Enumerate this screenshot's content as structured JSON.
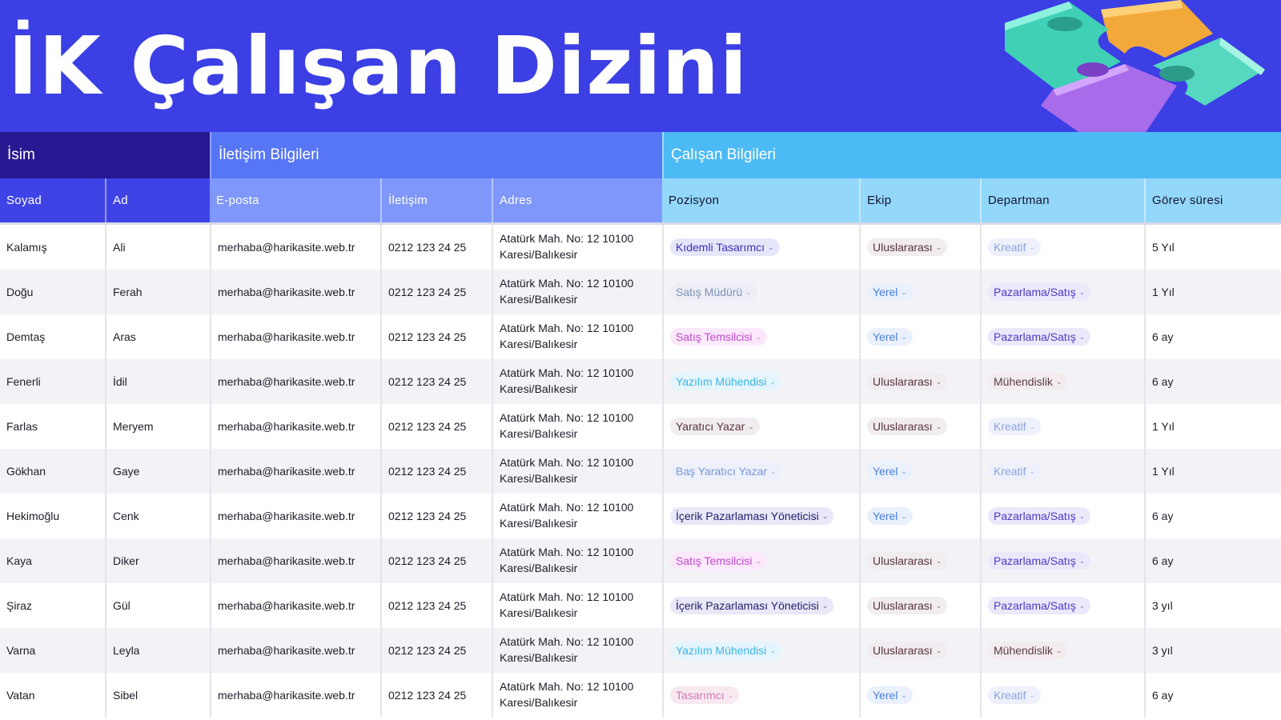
{
  "page": {
    "title": "İK Çalışan Dizini"
  },
  "groups": {
    "name": "İsim",
    "contact": "İletişim Bilgileri",
    "employee": "Çalışan Bilgileri"
  },
  "columns": {
    "surname": "Soyad",
    "first_name": "Ad",
    "email": "E-posta",
    "phone": "İletişim",
    "address": "Adres",
    "position": "Pozisyon",
    "team": "Ekip",
    "department": "Departman",
    "tenure": "Görev süresi"
  },
  "colors": {
    "banner": "#3b3fe4",
    "group_name": "#281891",
    "group_contact": "#5776f5",
    "group_employee": "#4bbaf5",
    "header_name": "#3f43e6",
    "header_contact": "#7f97fa",
    "header_employee": "#93d7fb"
  },
  "rows": [
    {
      "surname": "Kalamış",
      "first_name": "Ali",
      "email": "merhaba@harikasite.web.tr",
      "phone": "0212 123 24 25",
      "address_line1": "Atatürk Mah. No: 12 10100",
      "address_line2": "Karesi/Balıkesir",
      "position": "Kıdemli Tasarımcı",
      "position_color": "indigo",
      "team": "Uluslararası",
      "team_color": "brown",
      "department": "Kreatif",
      "department_color": "periwinkle",
      "tenure": "5 Yıl"
    },
    {
      "surname": "Doğu",
      "first_name": "Ferah",
      "email": "merhaba@harikasite.web.tr",
      "phone": "0212 123 24 25",
      "address_line1": "Atatürk Mah. No: 12 10100",
      "address_line2": "Karesi/Balıkesir",
      "position": "Satış Müdürü",
      "position_color": "slate",
      "team": "Yerel",
      "team_color": "blue",
      "department": "Pazarlama/Satış",
      "department_color": "violet",
      "tenure": "1 Yıl"
    },
    {
      "surname": "Demtaş",
      "first_name": "Aras",
      "email": "merhaba@harikasite.web.tr",
      "phone": "0212 123 24 25",
      "address_line1": "Atatürk Mah. No: 12 10100",
      "address_line2": "Karesi/Balıkesir",
      "position": "Satış Temsilcisi",
      "position_color": "pink",
      "team": "Yerel",
      "team_color": "blue",
      "department": "Pazarlama/Satış",
      "department_color": "violet",
      "tenure": "6 ay"
    },
    {
      "surname": "Fenerli",
      "first_name": "İdil",
      "email": "merhaba@harikasite.web.tr",
      "phone": "0212 123 24 25",
      "address_line1": "Atatürk Mah. No: 12 10100",
      "address_line2": "Karesi/Balıkesir",
      "position": "Yazılım Mühendisi",
      "position_color": "cyan",
      "team": "Uluslararası",
      "team_color": "brown",
      "department": "Mühendislik",
      "department_color": "maroon",
      "tenure": "6 ay"
    },
    {
      "surname": "Farlas",
      "first_name": "Meryem",
      "email": "merhaba@harikasite.web.tr",
      "phone": "0212 123 24 25",
      "address_line1": "Atatürk Mah. No: 12 10100",
      "address_line2": "Karesi/Balıkesir",
      "position": "Yaratıcı Yazar",
      "position_color": "brown",
      "team": "Uluslararası",
      "team_color": "brown",
      "department": "Kreatif",
      "department_color": "periwinkle",
      "tenure": "1 Yıl"
    },
    {
      "surname": "Gökhan",
      "first_name": "Gaye",
      "email": "merhaba@harikasite.web.tr",
      "phone": "0212 123 24 25",
      "address_line1": "Atatürk Mah. No: 12 10100",
      "address_line2": "Karesi/Balıkesir",
      "position": "Baş Yaratıcı Yazar",
      "position_color": "lightblue",
      "team": "Yerel",
      "team_color": "blue",
      "department": "Kreatif",
      "department_color": "periwinkle",
      "tenure": "1 Yıl"
    },
    {
      "surname": "Hekimoğlu",
      "first_name": "Cenk",
      "email": "merhaba@harikasite.web.tr",
      "phone": "0212 123 24 25",
      "address_line1": "Atatürk Mah. No: 12 10100",
      "address_line2": "Karesi/Balıkesir",
      "position": "İçerik Pazarlaması Yöneticisi",
      "position_color": "navy",
      "team": "Yerel",
      "team_color": "blue",
      "department": "Pazarlama/Satış",
      "department_color": "violet",
      "tenure": "6 ay"
    },
    {
      "surname": "Kaya",
      "first_name": "Diker",
      "email": "merhaba@harikasite.web.tr",
      "phone": "0212 123 24 25",
      "address_line1": "Atatürk Mah. No: 12 10100",
      "address_line2": "Karesi/Balıkesir",
      "position": "Satış Temsilcisi",
      "position_color": "pink",
      "team": "Uluslararası",
      "team_color": "brown",
      "department": "Pazarlama/Satış",
      "department_color": "violet",
      "tenure": "6 ay"
    },
    {
      "surname": "Şiraz",
      "first_name": "Gül",
      "email": "merhaba@harikasite.web.tr",
      "phone": "0212 123 24 25",
      "address_line1": "Atatürk Mah. No: 12 10100",
      "address_line2": "Karesi/Balıkesir",
      "position": "İçerik Pazarlaması Yöneticisi",
      "position_color": "navy",
      "team": "Uluslararası",
      "team_color": "brown",
      "department": "Pazarlama/Satış",
      "department_color": "violet",
      "tenure": "3 yıl"
    },
    {
      "surname": "Varna",
      "first_name": "Leyla",
      "email": "merhaba@harikasite.web.tr",
      "phone": "0212 123 24 25",
      "address_line1": "Atatürk Mah. No: 12 10100",
      "address_line2": "Karesi/Balıkesir",
      "position": "Yazılım Mühendisi",
      "position_color": "cyan",
      "team": "Uluslararası",
      "team_color": "brown",
      "department": "Mühendislik",
      "department_color": "maroon",
      "tenure": "3 yıl"
    },
    {
      "surname": "Vatan",
      "first_name": "Sibel",
      "email": "merhaba@harikasite.web.tr",
      "phone": "0212 123 24 25",
      "address_line1": "Atatürk Mah. No: 12 10100",
      "address_line2": "Karesi/Balıkesir",
      "position": "Tasarımcı",
      "position_color": "dustypink",
      "team": "Yerel",
      "team_color": "blue",
      "department": "Kreatif",
      "department_color": "periwinkle",
      "tenure": "6 ay"
    }
  ]
}
